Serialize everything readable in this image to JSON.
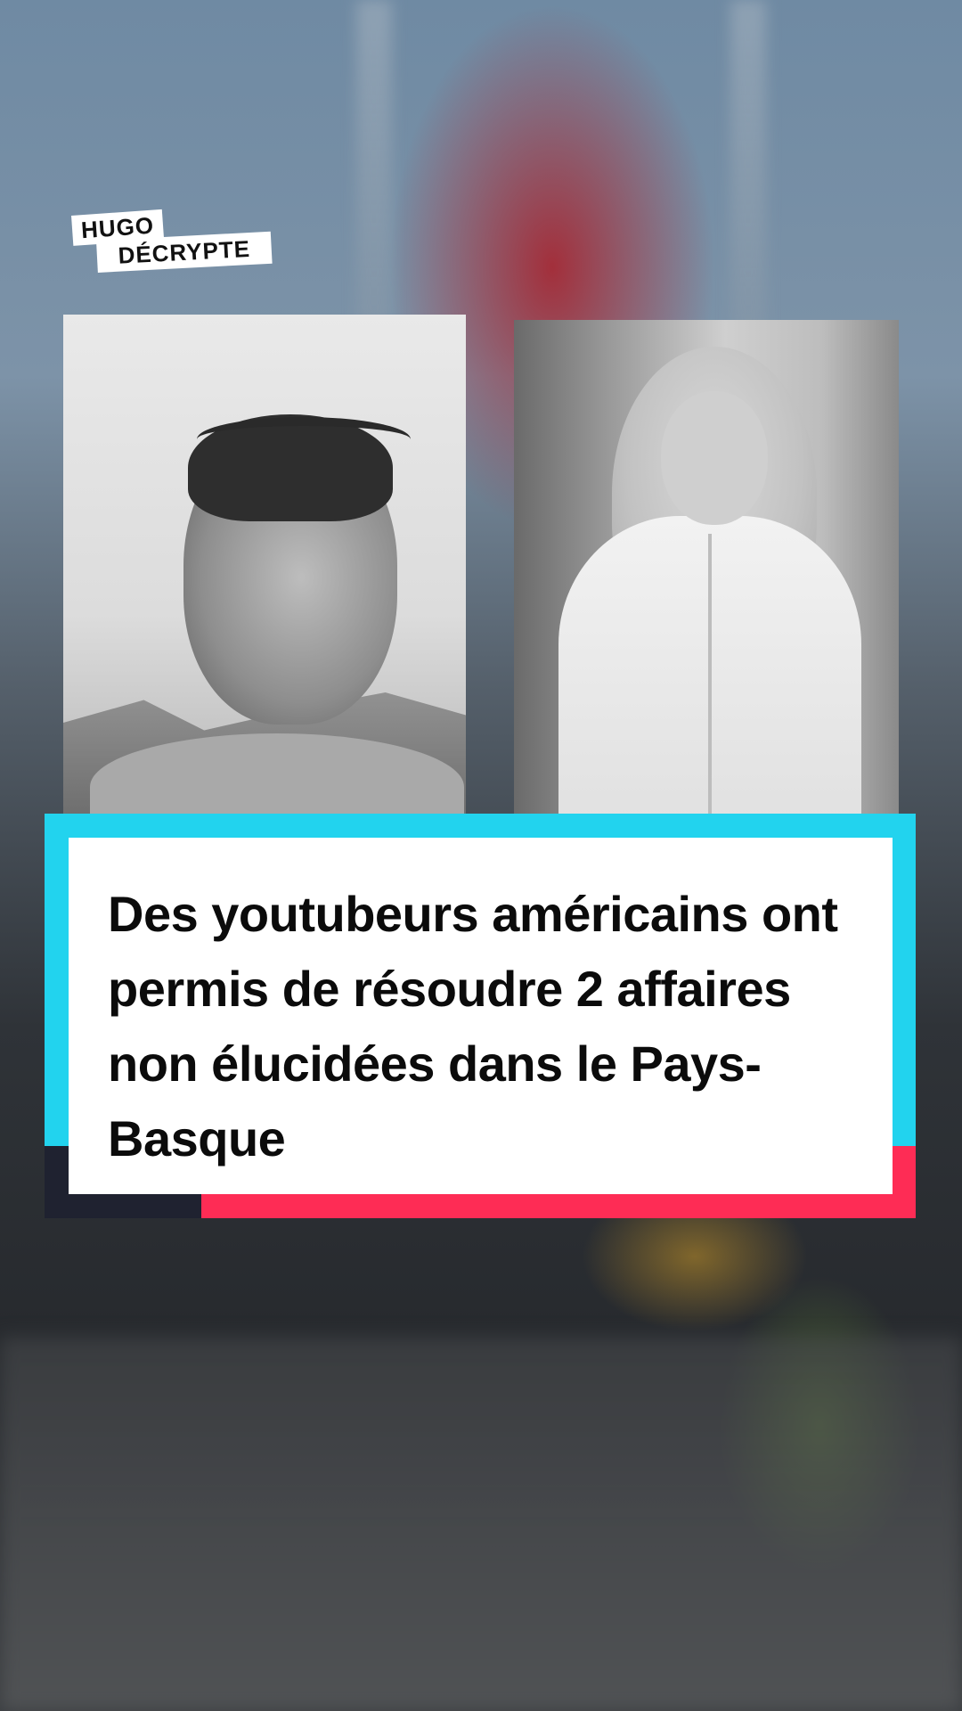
{
  "brand": {
    "logo_line1": "HUGO",
    "logo_line2": "DÉCRYPTE"
  },
  "photos": {
    "left": {
      "icon": "portrait-man-photo"
    },
    "right": {
      "icon": "portrait-woman-photo"
    }
  },
  "caption": {
    "text": "Des youtubeurs américains ont permis de résoudre 2 affaires non élucidées dans le Pays-Basque"
  },
  "colors": {
    "accent_cyan": "#22d3ee",
    "accent_red": "#fe2c55",
    "accent_dark": "#1f2230",
    "card_bg": "#ffffff"
  }
}
